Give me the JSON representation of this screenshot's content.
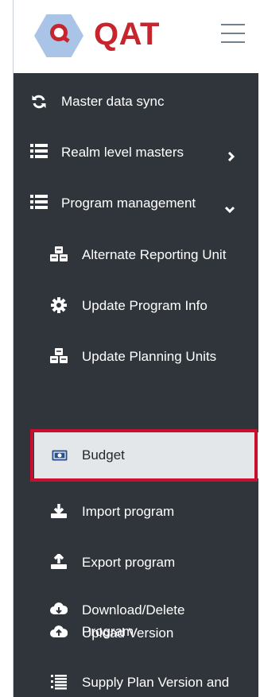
{
  "app": {
    "brand": "QAT"
  },
  "header": {
    "menu_toggle_icon": "hamburger-icon"
  },
  "sidebar": {
    "items": [
      {
        "label": "Master data sync",
        "icon": "sync-icon"
      },
      {
        "label": "Realm level masters",
        "icon": "list-icon",
        "expand": "chevron-right-icon"
      },
      {
        "label": "Program management",
        "icon": "list-icon",
        "expand": "chevron-down-icon"
      }
    ],
    "sub_items": [
      {
        "label": "Alternate Reporting Unit",
        "icon": "cubes-icon"
      },
      {
        "label": "Update Program Info",
        "icon": "gear-icon"
      },
      {
        "label": "Update Planning Units",
        "icon": "cubes-icon"
      },
      {
        "label": "Budget",
        "icon": "money-bill-icon",
        "active": true
      },
      {
        "label": "Import program",
        "icon": "download-icon"
      },
      {
        "label": "Export program",
        "icon": "upload-icon"
      },
      {
        "label": "Download/Delete Program",
        "label_line1": "Download/Delete",
        "label_line2": "Program",
        "icon": "cloud-download-icon"
      },
      {
        "label": "Upload Version",
        "icon": "cloud-upload-icon"
      },
      {
        "label": "Supply Plan Version and",
        "icon": "list-ordered-icon"
      }
    ]
  },
  "colors": {
    "sidebar_bg": "#2f353a",
    "brand_red": "#c6252d",
    "highlight_red": "#c8102e",
    "active_bg": "#e4e7ea"
  }
}
